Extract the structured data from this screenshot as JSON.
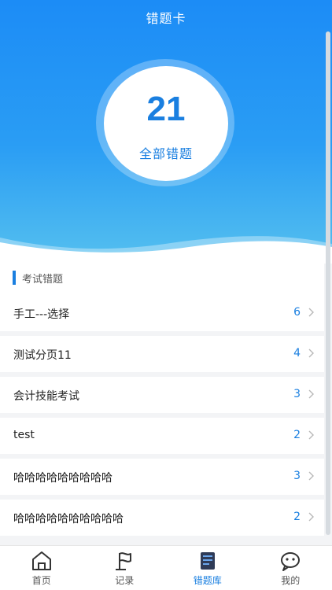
{
  "header": {
    "title": "错题卡",
    "total_count": "21",
    "total_label": "全部错题"
  },
  "section": {
    "title": "考试错题"
  },
  "list": [
    {
      "label": "手工---选择",
      "count": "6"
    },
    {
      "label": "测试分页11",
      "count": "4"
    },
    {
      "label": "会计技能考试",
      "count": "3"
    },
    {
      "label": "test",
      "count": "2"
    },
    {
      "label": "哈哈哈哈哈哈哈哈哈",
      "count": "3"
    },
    {
      "label": "哈哈哈哈哈哈哈哈哈哈",
      "count": "2"
    }
  ],
  "tabs": [
    {
      "label": "首页",
      "icon": "home-icon"
    },
    {
      "label": "记录",
      "icon": "flag-icon"
    },
    {
      "label": "错题库",
      "icon": "book-icon",
      "active": true
    },
    {
      "label": "我的",
      "icon": "face-icon"
    }
  ],
  "colors": {
    "accent": "#1a7fe0",
    "header_top": "#1c8cf6",
    "header_bottom": "#55c0ef"
  }
}
